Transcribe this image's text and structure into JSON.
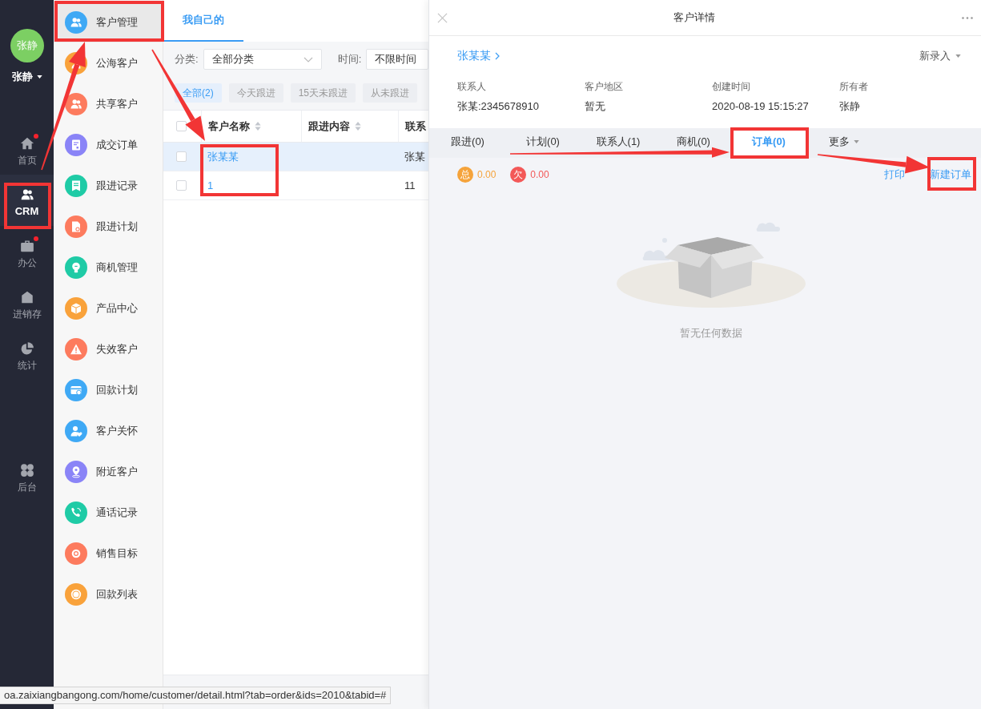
{
  "user": {
    "avatar": "张静",
    "name": "张静"
  },
  "nav": [
    {
      "label": "首页",
      "selected": false,
      "dot": true
    },
    {
      "label": "CRM",
      "selected": true,
      "dot": false
    },
    {
      "label": "办公",
      "selected": false,
      "dot": true
    },
    {
      "label": "进销存",
      "selected": false,
      "dot": false
    },
    {
      "label": "统计",
      "selected": false,
      "dot": false
    }
  ],
  "nav_bottom": [
    {
      "label": "后台",
      "selected": false
    }
  ],
  "submenu": [
    {
      "label": "客户管理",
      "selected": true,
      "color": "#3fa9f5"
    },
    {
      "label": "公海客户",
      "selected": false,
      "color": "#f9a23b"
    },
    {
      "label": "共享客户",
      "selected": false,
      "color": "#fd7b5e"
    },
    {
      "label": "成交订单",
      "selected": false,
      "color": "#8a84f7"
    },
    {
      "label": "跟进记录",
      "selected": false,
      "color": "#1fcba6"
    },
    {
      "label": "跟进计划",
      "selected": false,
      "color": "#fd7b5e"
    },
    {
      "label": "商机管理",
      "selected": false,
      "color": "#1fcba6"
    },
    {
      "label": "产品中心",
      "selected": false,
      "color": "#f9a23b"
    },
    {
      "label": "失效客户",
      "selected": false,
      "color": "#fd7b5e"
    },
    {
      "label": "回款计划",
      "selected": false,
      "color": "#3fa9f5"
    },
    {
      "label": "客户关怀",
      "selected": false,
      "color": "#3fa9f5"
    },
    {
      "label": "附近客户",
      "selected": false,
      "color": "#8a84f7"
    },
    {
      "label": "通话记录",
      "selected": false,
      "color": "#1fcba6"
    },
    {
      "label": "销售目标",
      "selected": false,
      "color": "#fd7b5e"
    },
    {
      "label": "回款列表",
      "selected": false,
      "color": "#f9a23b"
    }
  ],
  "list_panel": {
    "tabs": [
      {
        "label": "我自己的",
        "selected": true
      }
    ],
    "filters": [
      {
        "label": "分类:",
        "value": "全部分类",
        "caret": true
      },
      {
        "label": "时间:",
        "value": "不限时间",
        "caret": false
      }
    ],
    "chips": [
      {
        "label": "全部(2)",
        "selected": true
      },
      {
        "label": "今天跟进",
        "selected": false
      },
      {
        "label": "15天未跟进",
        "selected": false
      },
      {
        "label": "从未跟进",
        "selected": false
      }
    ],
    "table": {
      "all_checked": false,
      "columns": [
        {
          "label": "客户名称",
          "sortable": true
        },
        {
          "label": "跟进内容",
          "sortable": true
        },
        {
          "label": "联系",
          "sortable": false
        }
      ],
      "rows": [
        {
          "customer_name": "张某某",
          "column_3": "张某",
          "checked": false,
          "selected": true
        },
        {
          "customer_name": "1",
          "column_3": "11",
          "checked": false,
          "selected": false
        }
      ]
    }
  },
  "detail": {
    "title": "客户详情",
    "customer_name": "张某某",
    "new_entry": "新录入",
    "fields": [
      {
        "label": "联系人",
        "value": "张某:2345678910"
      },
      {
        "label": "客户地区",
        "value": "暂无"
      },
      {
        "label": "创建时间",
        "value": "2020-08-19 15:15:27"
      },
      {
        "label": "所有者",
        "value": "张静"
      }
    ],
    "tabs": [
      {
        "label": "跟进(0)",
        "selected": false,
        "caret": false
      },
      {
        "label": "计划(0)",
        "selected": false,
        "caret": false
      },
      {
        "label": "联系人(1)",
        "selected": false,
        "caret": false
      },
      {
        "label": "商机(0)",
        "selected": false,
        "caret": false
      },
      {
        "label": "订单(0)",
        "selected": true,
        "caret": false
      },
      {
        "label": "更多",
        "selected": false,
        "caret": true
      }
    ],
    "summary": [
      {
        "tag": "总",
        "amount": "0.00",
        "color": "#f5a33b"
      },
      {
        "tag": "欠",
        "amount": "0.00",
        "color": "#f35858"
      }
    ],
    "actions": [
      "打印",
      "新建订单"
    ],
    "empty_text": "暂无任何数据"
  },
  "status_url": "oa.zaixiangbangong.com/home/customer/detail.html?tab=order&ids=2010&tabid=#"
}
